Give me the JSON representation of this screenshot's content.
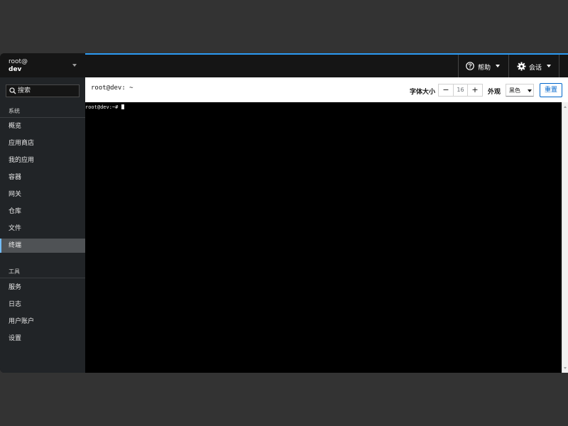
{
  "host": {
    "user": "root@",
    "name": "dev"
  },
  "sidebar": {
    "search_placeholder": "搜索",
    "group_system": "系统",
    "items": [
      {
        "label": "概览"
      },
      {
        "label": "应用商店"
      },
      {
        "label": "我的应用"
      },
      {
        "label": "容器"
      },
      {
        "label": "网关"
      },
      {
        "label": "仓库"
      },
      {
        "label": "文件"
      },
      {
        "label": "终端",
        "active": true
      }
    ],
    "group_tools": "工具",
    "tool_items": [
      {
        "label": "服务"
      },
      {
        "label": "日志"
      },
      {
        "label": "用户账户"
      },
      {
        "label": "设置"
      }
    ]
  },
  "header": {
    "help_label": "帮助",
    "session_label": "会话"
  },
  "toolbar": {
    "title": "root@dev: ~",
    "font_size_label": "字体大小",
    "font_size_value": "16",
    "decrement": "−",
    "increment": "+",
    "appearance_label": "外观",
    "appearance_value": "黑色",
    "reset_label": "重置"
  },
  "terminal": {
    "prompt": "root@dev:~# "
  },
  "colors": {
    "accent": "#2b9af3",
    "link": "#0066cc",
    "sidebar_bg": "#212427",
    "terminal_bg": "#000000"
  }
}
